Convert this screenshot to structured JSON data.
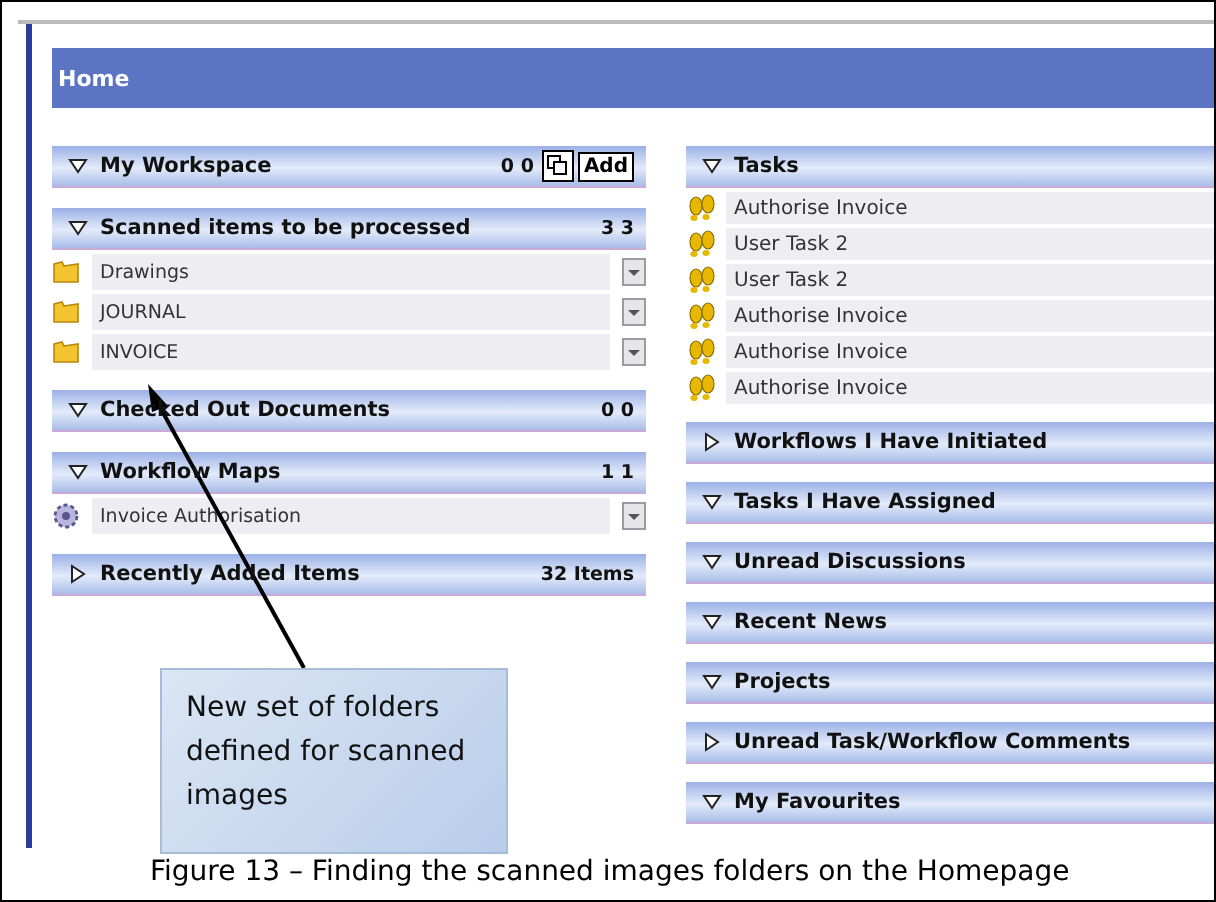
{
  "home_title": "Home",
  "left_panels": [
    {
      "title": "My Workspace",
      "expanded": true,
      "count": "0 0",
      "button": "Add"
    },
    {
      "title": "Scanned items to be processed",
      "expanded": true,
      "count": "3 3",
      "items": [
        {
          "label": "Drawings",
          "kind": "folder"
        },
        {
          "label": "JOURNAL",
          "kind": "folder"
        },
        {
          "label": "INVOICE",
          "kind": "folder"
        }
      ]
    },
    {
      "title": "Checked Out Documents",
      "expanded": true,
      "count": "0 0"
    },
    {
      "title": "Workflow Maps",
      "expanded": true,
      "count": "1 1",
      "items": [
        {
          "label": "Invoice Authorisation",
          "kind": "workflow"
        }
      ]
    },
    {
      "title": "Recently Added Items",
      "expanded": false,
      "count": "32 Items"
    }
  ],
  "right_panels": [
    {
      "title": "Tasks",
      "expanded": true,
      "items": [
        {
          "label": "Authorise Invoice",
          "kind": "task"
        },
        {
          "label": "User Task 2",
          "kind": "task"
        },
        {
          "label": "User Task 2",
          "kind": "task"
        },
        {
          "label": "Authorise Invoice",
          "kind": "task"
        },
        {
          "label": "Authorise Invoice",
          "kind": "task"
        },
        {
          "label": "Authorise Invoice",
          "kind": "task"
        }
      ]
    },
    {
      "title": "Workflows I Have Initiated",
      "expanded": false
    },
    {
      "title": "Tasks I Have Assigned",
      "expanded": true
    },
    {
      "title": "Unread Discussions",
      "expanded": true
    },
    {
      "title": "Recent News",
      "expanded": true
    },
    {
      "title": "Projects",
      "expanded": true
    },
    {
      "title": "Unread Task/Workflow Comments",
      "expanded": false
    },
    {
      "title": "My Favourites",
      "expanded": true
    }
  ],
  "callout": "New set of folders defined for scanned images",
  "caption": "Figure 13 – Finding the scanned images folders on the Homepage"
}
